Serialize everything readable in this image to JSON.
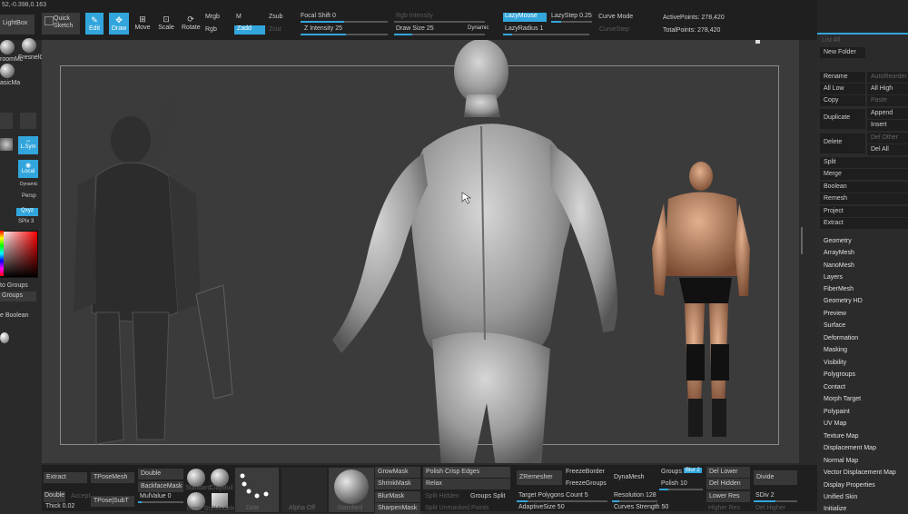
{
  "coords": "52,-0.398,0.163",
  "top_left": {
    "lightbox": "LightBox",
    "quick_sketch": "Quick Sketch"
  },
  "modes": {
    "edit": "Edit",
    "draw": "Draw",
    "move": "Move",
    "scale": "Scale",
    "rotate": "Rotate"
  },
  "rgb": {
    "mrgb": "Mrgb",
    "rgb": "Rgb",
    "m": "M",
    "zadd": "Zadd",
    "zsub": "Zsub",
    "zcut": "Zcut"
  },
  "sliders": {
    "focal_shift": "Focal Shift 0",
    "z_intensity": "Z Intensity 25",
    "rgb_intensity": "Rgb Intensity",
    "draw_size": "Draw Size 25",
    "dynamic": "Dynamic",
    "lazy_mouse": "LazyMouse",
    "lazy_step": "LazyStep 0.25",
    "lazy_radius": "LazyRadius 1",
    "curve_mode": "Curve Mode",
    "curve_step": "CurveStep"
  },
  "stats": {
    "active_points": "ActivePoints: 278,420",
    "total_points": "TotalPoints: 278,420"
  },
  "left_shelf": {
    "fresnel": "FresnelC",
    "mat1": "roomMc",
    "mat2": "asicMa",
    "lsym": "L.Sym",
    "local": "Local",
    "dynamic": "Dynamic",
    "persp": "Persp",
    "xyz": "Qxyz",
    "spix": "SPix 3",
    "auto_groups": "to Groups",
    "groups": "Groups",
    "boolean": "e Boolean"
  },
  "subtool": {
    "new_folder": "New Folder",
    "rename": "Rename",
    "autoreorder": "AutoReorder",
    "all_low": "All Low",
    "all_high": "All High",
    "copy": "Copy",
    "paste": "Paste",
    "duplicate": "Duplicate",
    "append": "Append",
    "insert": "Insert",
    "delete": "Delete",
    "del_other": "Del Other",
    "del_all": "Del All",
    "split": "Split",
    "merge": "Merge",
    "boolean": "Boolean",
    "remesh": "Remesh",
    "project": "Project",
    "extract": "Extract",
    "list_all": "List All"
  },
  "tool_menu": [
    "Geometry",
    "ArrayMesh",
    "NanoMesh",
    "Layers",
    "FiberMesh",
    "Geometry HD",
    "Preview",
    "Surface",
    "Deformation",
    "Masking",
    "Visibility",
    "Polygroups",
    "Contact",
    "Morph Target",
    "Polypaint",
    "UV Map",
    "Texture Map",
    "Displacement Map",
    "Normal Map",
    "Vector Displacement Map",
    "Display Properties",
    "Unified Skin",
    "Initialize"
  ],
  "bottom": {
    "extract": "Extract",
    "tposemesh": "TPoseMesh",
    "double": "Double",
    "backfacemask": "BackfaceMask",
    "mulvalue": "MulValue 0",
    "double2": "Double",
    "accept": "Accept",
    "thick": "Thick 0.02",
    "tpose_subt": "TPose|SubT",
    "standard": "Standard",
    "claybuild": "ClayBuil",
    "dam": "Dam_St",
    "zmodeler": "ZModeler",
    "dots": "Dots",
    "alpha_off": "Alpha Off",
    "standard2": "Standard",
    "growmask": "GrowMask",
    "shrinkmask": "ShrinkMask",
    "blurmask": "BlurMask",
    "sharpenmask": "SharpenMask",
    "polish_crisp": "Polish Crisp Edges",
    "relax": "Relax",
    "split_hidden": "Split Hidden",
    "groups_split": "Groups Split",
    "split_unmasked": "Split Unmasked Points",
    "zremesher": "ZRemesher",
    "freezeborder": "FreezeBorder",
    "freezegroups": "FreezeGroups",
    "target_polys": "Target Polygons Count 5",
    "adaptive_size": "AdaptiveSize 50",
    "dynamesh": "DynaMesh",
    "resolution": "Resolution 128",
    "curves_strength": "Curves Strength 50",
    "groups": "Groups",
    "blur": "Blur 2",
    "polish": "Polish 10",
    "del_lower": "Del Lower",
    "del_hidden": "Del Hidden",
    "lower_res": "Lower Res",
    "higher_res": "Higher Res",
    "divide": "Divide",
    "sdiv": "SDiv 2",
    "del_higher": "Del Higher"
  },
  "colors": {
    "accent": "#32a6dc",
    "bg": "#2b2b2b",
    "panel": "#1f1f1f",
    "canvas": "#404040"
  },
  "progress": {
    "focal_shift": 0.0,
    "z_intensity": 0.25,
    "draw_size": 0.05
  }
}
